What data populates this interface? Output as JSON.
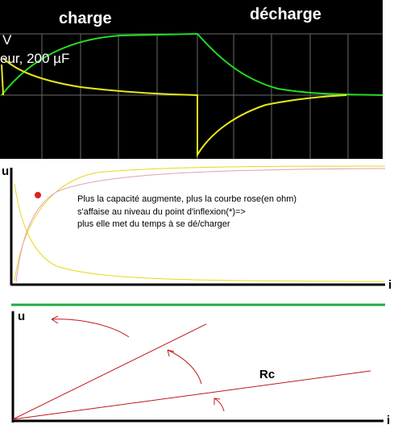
{
  "scope": {
    "label_charge": "charge",
    "label_decharge": "décharge",
    "label_volt": "V",
    "label_capacitor": "eur, 200 µF",
    "colors": {
      "background": "#000000",
      "grid": "#6a6a6a",
      "charge_curve": "#22dd22",
      "current_curve": "#e8e81a"
    }
  },
  "graph2": {
    "y_axis_label": "u",
    "x_axis_label": "i",
    "note_line1": "Plus la capacité augmente, plus la courbe rose(en ohm)",
    "note_line2": "s'affaise au niveau du point d'inflexion(*)=>",
    "note_line3": "plus elle met du temps à se dé/charger",
    "colors": {
      "axis": "#000000",
      "yellow_curve": "#e6d820",
      "pink_curve": "#e0a0b0",
      "marker": "#e02020"
    }
  },
  "graph3": {
    "y_axis_label": "u",
    "x_axis_label": "i",
    "line_label": "Rc",
    "colors": {
      "axis": "#000000",
      "lines": "#c01818",
      "top_rule": "#22aa44"
    }
  }
}
